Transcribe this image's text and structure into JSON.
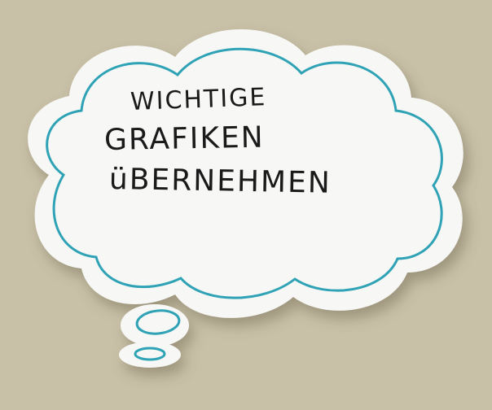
{
  "note": {
    "lines": [
      "WICHTIGE",
      "GRAFIKEN",
      "üBERNEHMEN"
    ]
  },
  "colors": {
    "background": "#c8c0a7",
    "paper": "#f7f8f6",
    "outline": "#2fa3b5",
    "ink": "#1a1a1a"
  }
}
